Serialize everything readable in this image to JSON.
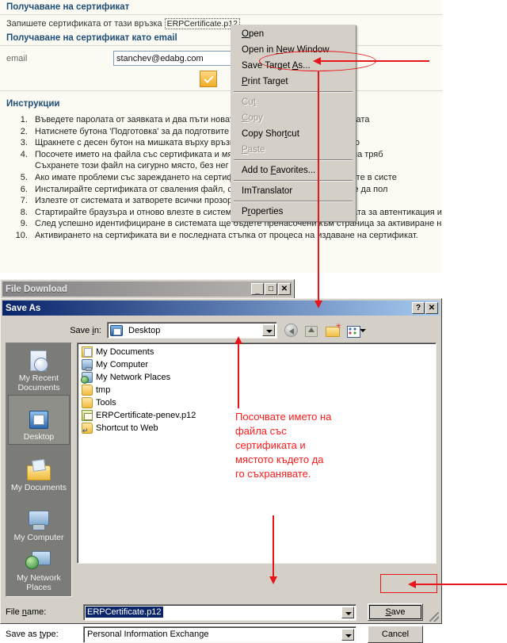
{
  "webpage": {
    "section1_title": "Получаване на сертификат",
    "line1_prefix": "Запишете сертификата от тази връзка",
    "cert_link": "ERPCertificate.p12",
    "section2_title": "Получаване на сертификат като email",
    "email_label": "email",
    "email_value": "stanchev@edabg.com",
    "ok_button_icon": "check-icon",
    "instructions_title": "Инструкции",
    "instructions": [
      "Въведете паролата от заявката и два пъти новата парола за сертификата. Новата",
      "Натиснете бутона 'Подготовка' за да подготвите сертификата като файл.",
      "Щракнете с десен бутон на мишката върху връзката и изберете от контекстното",
      "Посочете името на файла със сертификата и мястото за запис. Името на файла тряб",
      "Ако имате проблеми със зареждането на сертификата, за да се идентифицирате в систе",
      "Инсталирайте сертификата от сваления файл, след сваляне на файла, можете да пол",
      "Излезте от системата и затворете всички прозорци на вашия браузър.",
      "Стартирайте браузъра и отново влезте в системата. При отваряне на страницата за автентикация и",
      "След успешно идентифициране в системата ще бъдете пренасочени към страница за активиране на",
      "Активирането на сертификата ви е последната стъпка от процеса на издаване на сертификат."
    ],
    "instruction_4_sub": "Съхранете този файл на сигурно място, без нег"
  },
  "context_menu": {
    "items": [
      {
        "label": "Open",
        "accel": "O",
        "disabled": false
      },
      {
        "label": "Open in New Window",
        "accel": "N",
        "disabled": false
      },
      {
        "label": "Save Target As...",
        "accel": "A",
        "disabled": false
      },
      {
        "label": "Print Target",
        "accel": "P",
        "disabled": false
      },
      {
        "label": "Cut",
        "accel": "t",
        "disabled": true
      },
      {
        "label": "Copy",
        "accel": "C",
        "disabled": true
      },
      {
        "label": "Copy Shortcut",
        "accel": "t",
        "disabled": false
      },
      {
        "label": "Paste",
        "accel": "P",
        "disabled": true
      },
      {
        "label": "Add to Favorites...",
        "accel": "F",
        "disabled": false
      },
      {
        "label": "ImTranslator",
        "accel": "",
        "disabled": false
      },
      {
        "label": "Properties",
        "accel": "r",
        "disabled": false
      }
    ]
  },
  "file_download_window": {
    "title": "File Download",
    "minimize_label": "_",
    "maximize_label": "□",
    "close_label": "✕"
  },
  "save_as_dialog": {
    "title": "Save As",
    "help_label": "?",
    "close_label": "✕",
    "save_in_label": "Save in:",
    "save_in_value": "Desktop",
    "toolbar_icons": [
      "back-icon",
      "up-one-level-icon",
      "new-folder-icon",
      "views-icon"
    ],
    "places": [
      {
        "label": "My Recent\nDocuments",
        "icon": "recent-documents-icon",
        "selected": false
      },
      {
        "label": "Desktop",
        "icon": "desktop-icon",
        "selected": true
      },
      {
        "label": "My Documents",
        "icon": "my-documents-icon",
        "selected": false
      },
      {
        "label": "My Computer",
        "icon": "my-computer-icon",
        "selected": false
      },
      {
        "label": "My Network\nPlaces",
        "icon": "my-network-places-icon",
        "selected": false
      }
    ],
    "files": [
      {
        "name": "My Documents",
        "icon": "my-documents-folder-icon"
      },
      {
        "name": "My Computer",
        "icon": "my-computer-icon"
      },
      {
        "name": "My Network Places",
        "icon": "my-network-places-icon"
      },
      {
        "name": "tmp",
        "icon": "folder-icon"
      },
      {
        "name": "Tools",
        "icon": "folder-icon"
      },
      {
        "name": "ERPCertificate-penev.p12",
        "icon": "certificate-file-icon"
      },
      {
        "name": "Shortcut to Web",
        "icon": "folder-shortcut-icon"
      }
    ],
    "file_name_label": "File name:",
    "file_name_value": "ERPCertificate.p12",
    "save_as_type_label": "Save as type:",
    "save_as_type_value": "Personal Information Exchange",
    "save_button": "Save",
    "cancel_button": "Cancel"
  },
  "annotations": {
    "red_note": "Посочвате името на файла със сертификата и мястото където да го съхранявате.",
    "accent_color": "#e8161b",
    "note_color": "#ff1a1a"
  }
}
